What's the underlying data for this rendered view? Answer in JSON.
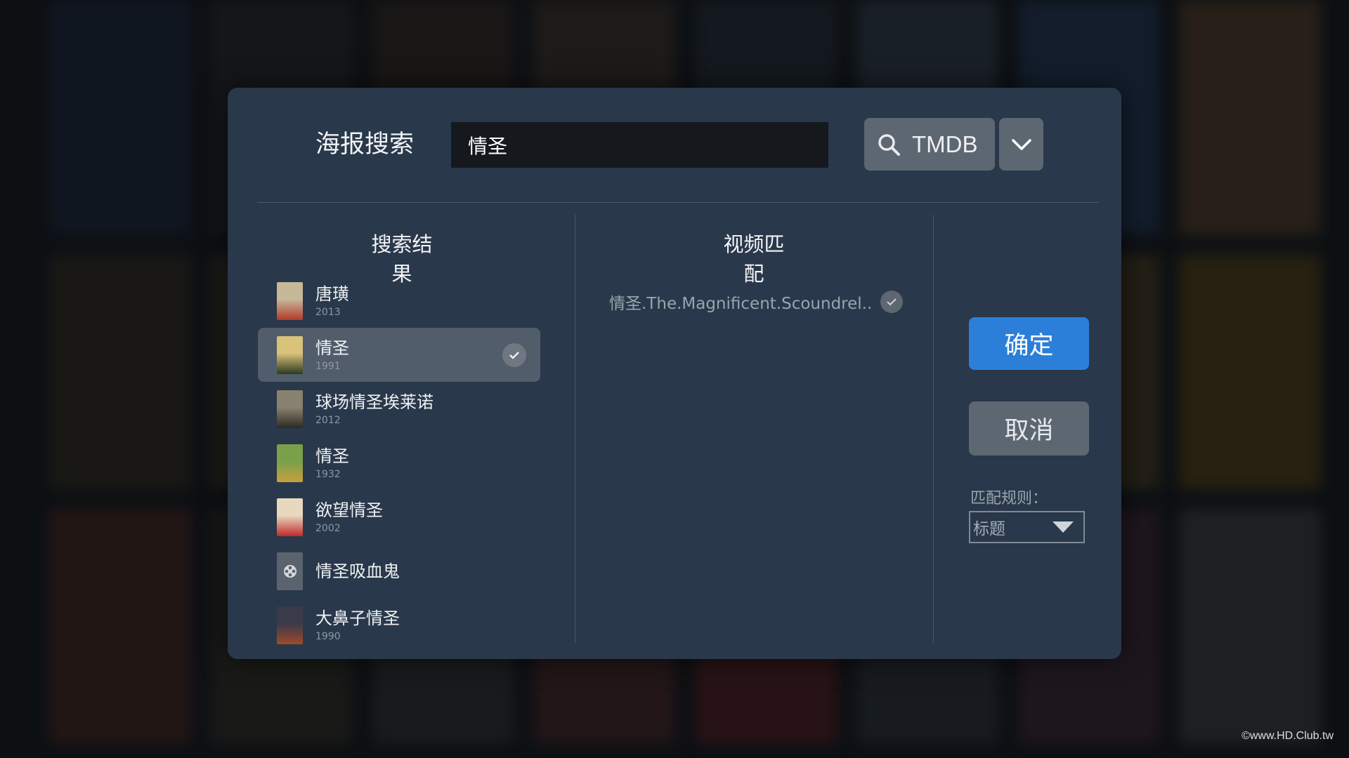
{
  "background": {
    "tiles": [
      "#1c2a44",
      "#2d2a2a",
      "#3b2c24",
      "#4a3a2c",
      "#2a3440",
      "#3a4a5a",
      "#26406a",
      "#6a4a2a",
      "#3a3020",
      "#4b3c2a",
      "#5a3a1c",
      "#332a25",
      "#2e3138",
      "#4a3426",
      "#5c4a24",
      "#6b4d12",
      "#5a2a20",
      "#3b3526",
      "#3a3836",
      "#5a2a2a",
      "#6a2020",
      "#333a40",
      "#4b2a3a",
      "#4a4a4a"
    ],
    "watermark": "©www.HD.Club.tw"
  },
  "dialog": {
    "title": "海报搜索",
    "search": {
      "value": "情圣",
      "placeholder": ""
    },
    "source": {
      "label": "TMDB"
    }
  },
  "results": {
    "heading": "搜索结果",
    "items": [
      {
        "title": "唐璜",
        "year": "2013",
        "selected": false,
        "poster_colors": [
          "#c8b89a",
          "#b33a2a"
        ]
      },
      {
        "title": "情圣",
        "year": "1991",
        "selected": true,
        "poster_colors": [
          "#d9c27a",
          "#2a3a1e"
        ]
      },
      {
        "title": "球场情圣埃莱诺",
        "year": "2012",
        "selected": false,
        "poster_colors": [
          "#8a8270",
          "#2a2a22"
        ]
      },
      {
        "title": "情圣",
        "year": "1932",
        "selected": false,
        "poster_colors": [
          "#7aa04a",
          "#c8a040"
        ]
      },
      {
        "title": "欲望情圣",
        "year": "2002",
        "selected": false,
        "poster_colors": [
          "#e8d8c0",
          "#c02a2a"
        ]
      },
      {
        "title": "情圣吸血鬼",
        "year": "",
        "selected": false,
        "poster_colors": []
      },
      {
        "title": "大鼻子情圣",
        "year": "1990",
        "selected": false,
        "poster_colors": [
          "#3a3a4a",
          "#a04a2a"
        ]
      }
    ]
  },
  "match": {
    "heading": "视频匹配",
    "filename": "情圣.The.Magnificent.Scoundrel.."
  },
  "actions": {
    "confirm": "确定",
    "cancel": "取消",
    "rule_label": "匹配规则：",
    "rule_value": "标题"
  },
  "colors": {
    "accent": "#2b7fd9",
    "dialog_bg": "#29384a"
  }
}
